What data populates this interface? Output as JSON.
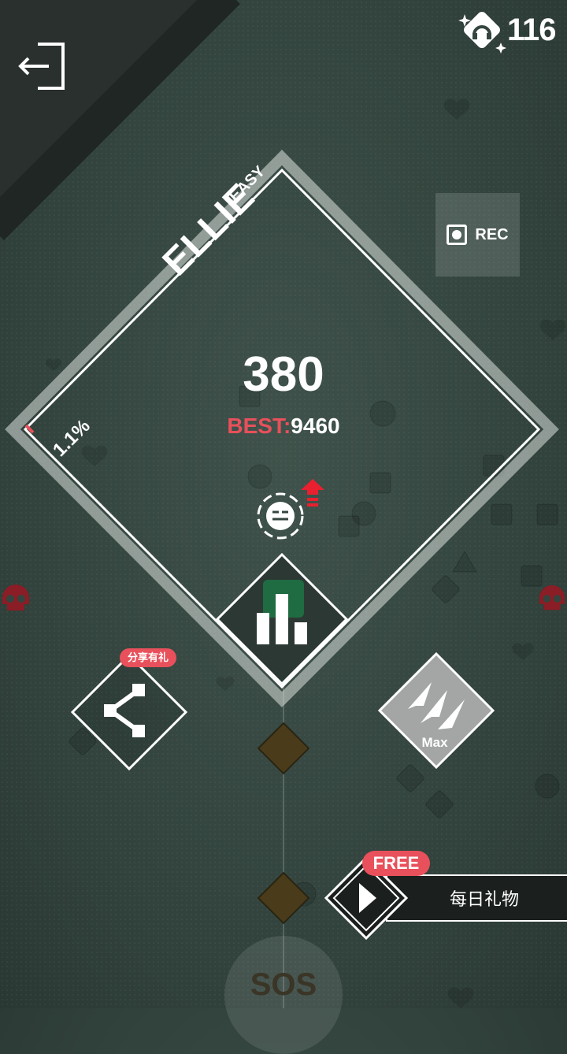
{
  "hud": {
    "coins": "116",
    "rec_label": "REC"
  },
  "song": {
    "title": "ELLIE",
    "difficulty": "EASY",
    "progress": "1.1%",
    "score": "380",
    "best_label": "BEST:",
    "best_value": "9460"
  },
  "actions": {
    "share_badge": "分享有礼",
    "max_label": "Max",
    "free_badge": "FREE",
    "daily_gift": "每日礼物",
    "sos_label": "SOS"
  },
  "colors": {
    "accent": "#e8505b",
    "background": "#34453f",
    "gold": "#4a3c1a"
  },
  "icons": [
    "exit-icon",
    "coin-icon",
    "record-icon",
    "ranking-icon",
    "share-icon",
    "max-boost-icon",
    "play-icon",
    "skull-icon",
    "face-icon",
    "upgrade-arrow-icon"
  ]
}
